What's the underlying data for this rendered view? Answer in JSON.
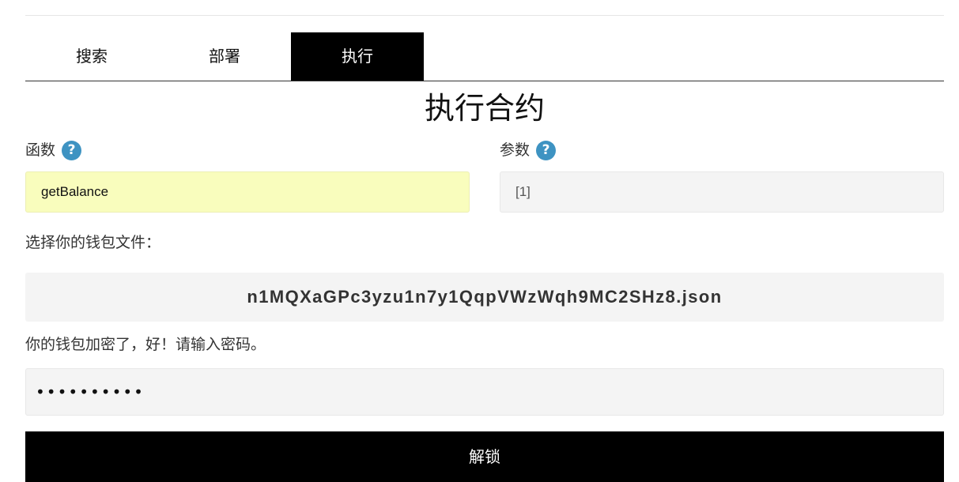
{
  "tabs": [
    {
      "label": "搜索",
      "active": false
    },
    {
      "label": "部署",
      "active": false
    },
    {
      "label": "执行",
      "active": true
    }
  ],
  "title": "执行合约",
  "function_field": {
    "label": "函数",
    "help_icon": "?",
    "value": "getBalance"
  },
  "params_field": {
    "label": "参数",
    "help_icon": "?",
    "value": "[1]"
  },
  "wallet": {
    "select_label": "选择你的钱包文件：",
    "file_name": "n1MQXaGPc3yzu1n7y1QqpVWzWqh9MC2SHz8.json",
    "encrypted_note": "你的钱包加密了，好！请输入密码。",
    "password_value": "••••••••••"
  },
  "unlock_button": {
    "label": "解锁"
  },
  "colors": {
    "active_tab_bg": "#000000",
    "help_icon": "#3e93c2",
    "highlight_input": "#f9fdbd",
    "input_bg": "#f4f4f4",
    "button_bg": "#000000"
  }
}
